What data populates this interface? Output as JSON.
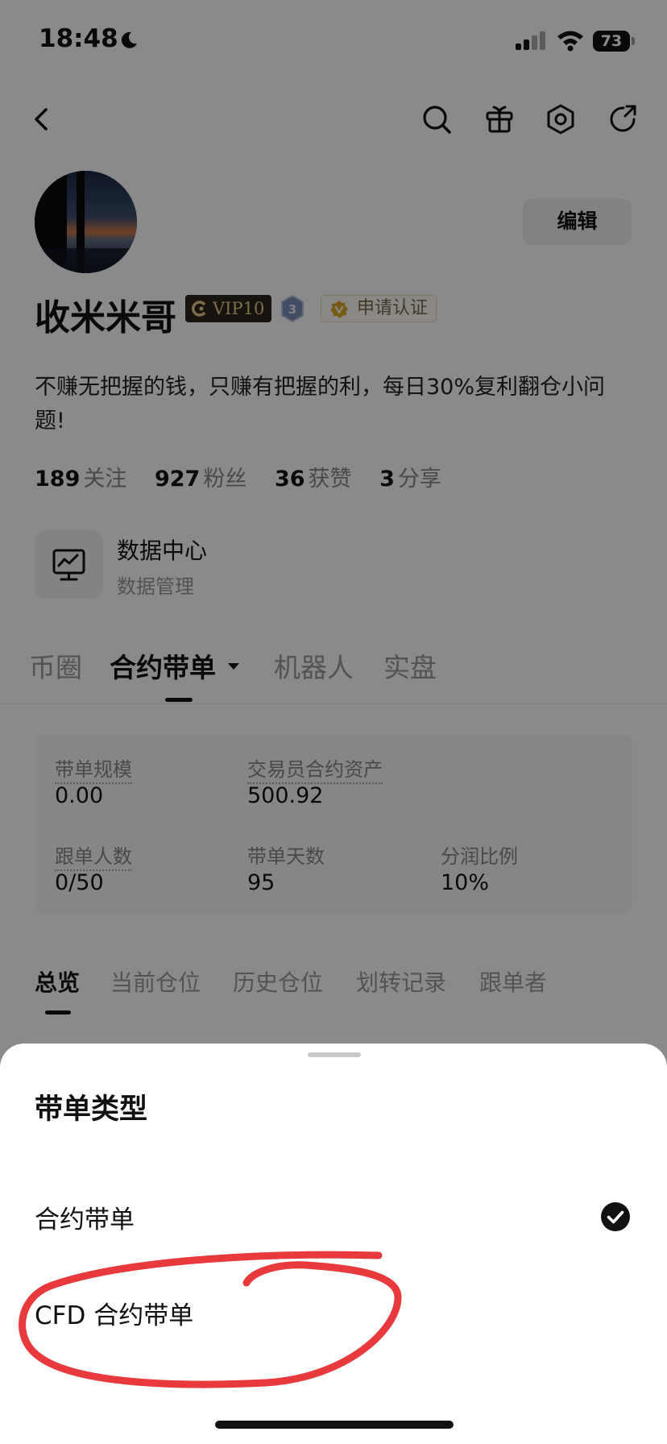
{
  "status_bar": {
    "time": "18:48",
    "battery": "73"
  },
  "profile": {
    "edit_label": "编辑",
    "username": "收米米哥",
    "vip_label": "VIP10",
    "level": "3",
    "certify_label": "申请认证",
    "bio": "不赚无把握的钱，只赚有把握的利，每日30%复利翻仓小问题!",
    "stats": [
      {
        "value": "189",
        "label": "关注"
      },
      {
        "value": "927",
        "label": "粉丝"
      },
      {
        "value": "36",
        "label": "获赞"
      },
      {
        "value": "3",
        "label": "分享"
      }
    ]
  },
  "data_center": {
    "title": "数据中心",
    "subtitle": "数据管理"
  },
  "main_tabs": [
    "币圈",
    "合约带单",
    "机器人",
    "实盘"
  ],
  "card": {
    "scale_label": "带单规模",
    "scale_value": "0.00",
    "assets_label": "交易员合约资产",
    "assets_value": "500.92",
    "followers_label": "跟单人数",
    "followers_value": "0/50",
    "days_label": "带单天数",
    "days_value": "95",
    "share_label": "分润比例",
    "share_value": "10%"
  },
  "sub_tabs": [
    "总览",
    "当前仓位",
    "历史仓位",
    "划转记录",
    "跟单者"
  ],
  "sheet": {
    "title": "带单类型",
    "options": [
      "合约带单",
      "CFD 合约带单"
    ],
    "selected_index": 0
  },
  "colors": {
    "annotation": "#e8393c",
    "vip_gold": "#e7c98b"
  }
}
